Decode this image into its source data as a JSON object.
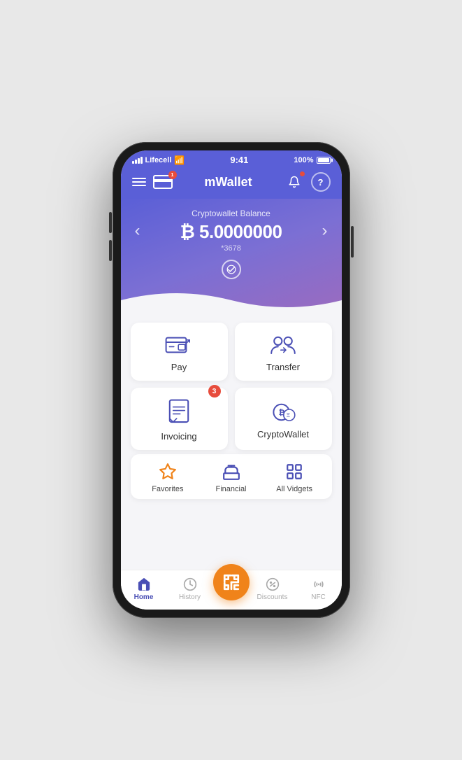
{
  "status_bar": {
    "carrier": "Lifecell",
    "time": "9:41",
    "battery": "100%",
    "wifi_icon": "wifi",
    "signal_icon": "signal"
  },
  "header": {
    "title": "mWallet",
    "card_badge": "1",
    "bell_badge": true,
    "help_label": "?"
  },
  "balance": {
    "label": "Cryptowallet Balance",
    "currency_symbol": "₿",
    "amount": "5.0000000",
    "account_id": "*3678",
    "left_arrow": "‹",
    "right_arrow": "›"
  },
  "grid": {
    "items": [
      {
        "label": "Pay",
        "badge": null
      },
      {
        "label": "Transfer",
        "badge": null
      },
      {
        "label": "Invoicing",
        "badge": "3"
      },
      {
        "label": "CryptoWallet",
        "badge": null
      }
    ]
  },
  "widgets": {
    "items": [
      {
        "label": "Favorites",
        "type": "star"
      },
      {
        "label": "Financial",
        "type": "bank"
      },
      {
        "label": "All Vidgets",
        "type": "grid"
      }
    ]
  },
  "bottom_nav": {
    "items": [
      {
        "label": "Home",
        "active": true,
        "icon": "home"
      },
      {
        "label": "History",
        "active": false,
        "icon": "clock"
      },
      {
        "label": "",
        "active": false,
        "icon": "scan",
        "is_scan": true
      },
      {
        "label": "Discounts",
        "active": false,
        "icon": "tag"
      },
      {
        "label": "NFC",
        "active": false,
        "icon": "nfc"
      }
    ],
    "scan_label": ""
  },
  "colors": {
    "primary": "#5a5fd7",
    "accent": "#f0831a",
    "badge": "#e74c3c"
  }
}
